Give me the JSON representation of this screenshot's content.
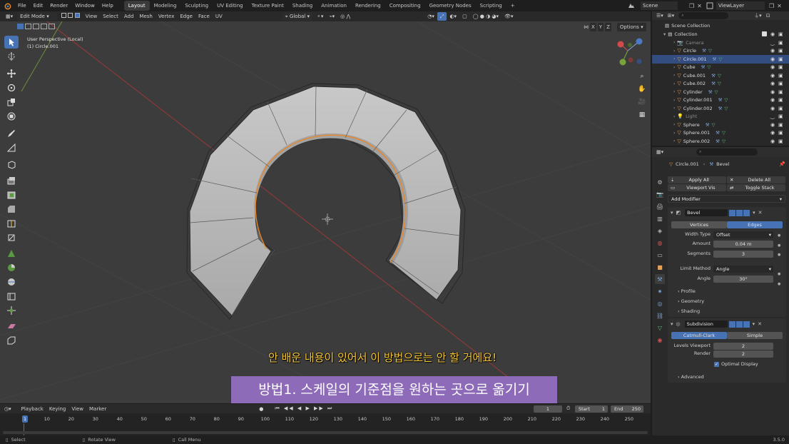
{
  "topbar": {
    "menus": [
      "File",
      "Edit",
      "Render",
      "Window",
      "Help"
    ],
    "workspaces": [
      "Layout",
      "Modeling",
      "Sculpting",
      "UV Editing",
      "Texture Paint",
      "Shading",
      "Animation",
      "Rendering",
      "Compositing",
      "Geometry Nodes",
      "Scripting"
    ],
    "active_workspace": "Layout",
    "add_workspace": "+",
    "scene": "Scene",
    "view_layer": "ViewLayer"
  },
  "viewport_header": {
    "mode": "Edit Mode",
    "menus": [
      "View",
      "Select",
      "Add",
      "Mesh",
      "Vertex",
      "Edge",
      "Face",
      "UV"
    ],
    "orientation": "Global",
    "axes": [
      "X",
      "Y",
      "Z"
    ],
    "options": "Options"
  },
  "viewport": {
    "view_name": "User Perspective (Local)",
    "object_name": "(1) Circle.001"
  },
  "captions": {
    "top": "안 배운 내용이 있어서 이 방법으로는 안 할 거에요!",
    "bottom": "방법1. 스케일의 기준점을 원하는 곳으로 옮기기"
  },
  "outliner": {
    "scene_collection": "Scene Collection",
    "collection": "Collection",
    "items": [
      {
        "name": "Camera",
        "type": "camera",
        "dim": true
      },
      {
        "name": "Circle",
        "type": "mesh"
      },
      {
        "name": "Circle.001",
        "type": "mesh",
        "selected": true
      },
      {
        "name": "Cube",
        "type": "mesh"
      },
      {
        "name": "Cube.001",
        "type": "mesh"
      },
      {
        "name": "Cube.002",
        "type": "mesh"
      },
      {
        "name": "Cylinder",
        "type": "mesh"
      },
      {
        "name": "Cylinder.001",
        "type": "mesh"
      },
      {
        "name": "Cylinder.002",
        "type": "mesh"
      },
      {
        "name": "Light",
        "type": "light",
        "dim": true
      },
      {
        "name": "Sphere",
        "type": "mesh"
      },
      {
        "name": "Sphere.001",
        "type": "mesh"
      },
      {
        "name": "Sphere.002",
        "type": "mesh"
      }
    ]
  },
  "properties": {
    "breadcrumb_object": "Circle.001",
    "breadcrumb_modifier": "Bevel",
    "apply_all": "Apply All",
    "delete_all": "Delete All",
    "viewport_vis": "Viewport Vis",
    "toggle_stack": "Toggle Stack",
    "add_modifier": "Add Modifier",
    "bevel": {
      "name": "Bevel",
      "affect_vertices": "Vertices",
      "affect_edges": "Edges",
      "width_type_label": "Width Type",
      "width_type": "Offset",
      "amount_label": "Amount",
      "amount": "0.04 m",
      "segments_label": "Segments",
      "segments": "3",
      "limit_method_label": "Limit Method",
      "limit_method": "Angle",
      "angle_label": "Angle",
      "angle": "30°",
      "profile": "Profile",
      "geometry": "Geometry",
      "shading": "Shading"
    },
    "subdivision": {
      "name": "Subdivision",
      "catmull": "Catmull-Clark",
      "simple": "Simple",
      "levels_viewport_label": "Levels Viewport",
      "levels_viewport": "2",
      "render_label": "Render",
      "render": "2",
      "optimal_display": "Optimal Display",
      "advanced": "Advanced"
    }
  },
  "timeline": {
    "menus": [
      "Playback",
      "Keying",
      "View",
      "Marker"
    ],
    "current_frame": "1",
    "start_label": "Start",
    "start": "1",
    "end_label": "End",
    "end": "250",
    "ticks": [
      "1",
      "10",
      "20",
      "30",
      "40",
      "50",
      "60",
      "70",
      "80",
      "90",
      "100",
      "110",
      "120",
      "130",
      "140",
      "150",
      "160",
      "170",
      "180",
      "190",
      "200",
      "210",
      "220",
      "230",
      "240",
      "250"
    ]
  },
  "statusbar": {
    "select": "Select",
    "rotate": "Rotate View",
    "call_menu": "Call Menu",
    "version": "3.5.0"
  },
  "colors": {
    "accent": "#4772b3",
    "caption_yellow": "#f5c535",
    "caption_bg": "#8d6bb8",
    "selected_row": "#334d80",
    "mesh_face": "#bdbdbd",
    "edge_highlight": "#e8882a"
  }
}
